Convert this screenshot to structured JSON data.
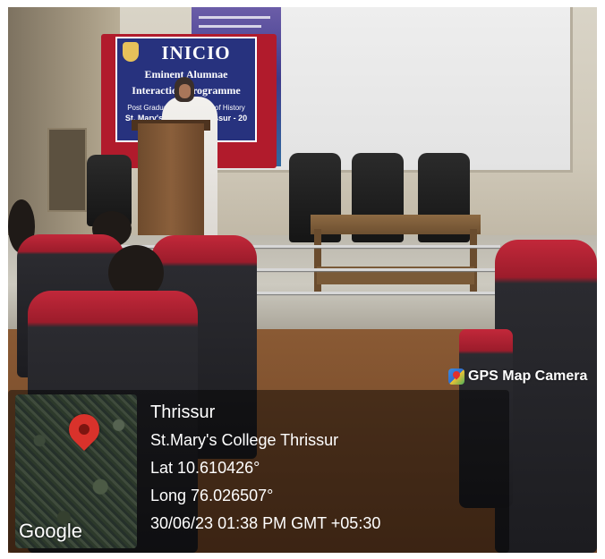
{
  "banner": {
    "title": "INICIO",
    "line1": "Eminent Alumnae",
    "line2": "Interaction Programme",
    "line3": "Post Graduate Department of History",
    "line4": "St. Mary's College, Thrissur - 20"
  },
  "overlay": {
    "brand_icon": "gps-map-camera-icon",
    "brand_label": "GPS Map Camera",
    "map_logo": "Google",
    "pin_icon": "map-pin-icon",
    "city": "Thrissur",
    "place": "St.Mary's College Thrissur",
    "latitude": "Lat 10.610426°",
    "longitude": "Long 76.026507°",
    "datetime": "30/06/23 01:38 PM GMT +05:30"
  },
  "colors": {
    "banner_red": "#b11b2c",
    "banner_blue": "#27327e",
    "pin_red": "#d9322b",
    "seat_red": "#c2283a"
  }
}
